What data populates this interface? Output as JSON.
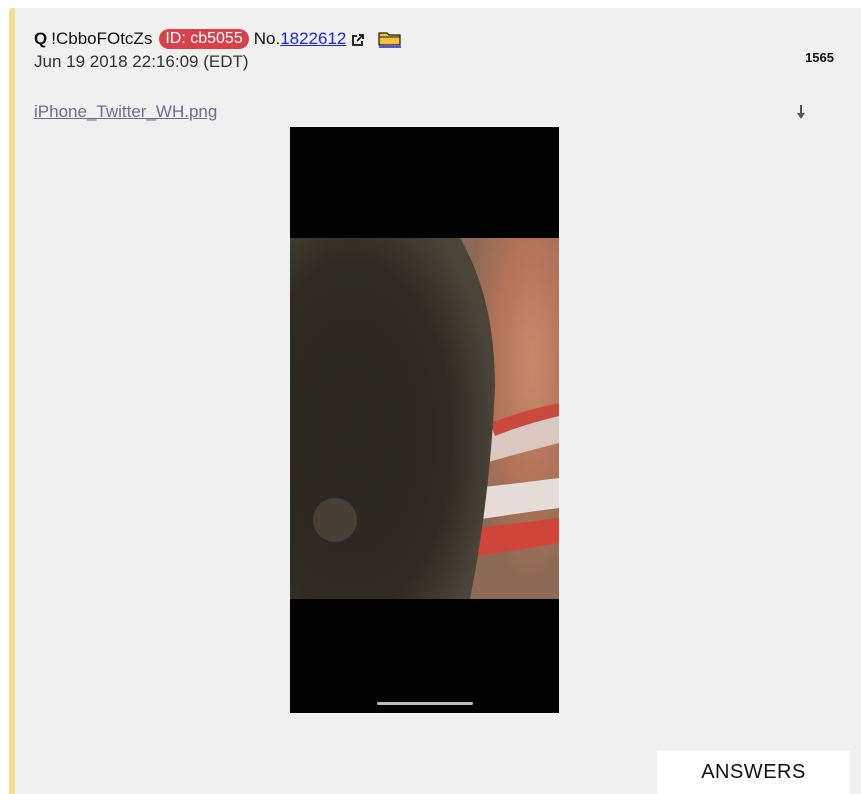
{
  "post": {
    "author": "Q",
    "tripcode": "!CbboFOtcZs",
    "id_badge": "ID: cb5055",
    "no_label": "No.",
    "post_number": "1822612",
    "date": "Jun 19 2018 22:16:09 (EDT)",
    "count": "1565",
    "filename": "iPhone_Twitter_WH.png",
    "answers_label": "ANSWERS"
  },
  "colors": {
    "accent_bar": "#efe08a",
    "id_badge_bg": "#d6414a",
    "link": "#1a24e0",
    "post_bg": "#f0f0f0"
  },
  "icons": {
    "external_link": "external-link-icon",
    "folder": "folder-icon",
    "download": "download-icon"
  }
}
